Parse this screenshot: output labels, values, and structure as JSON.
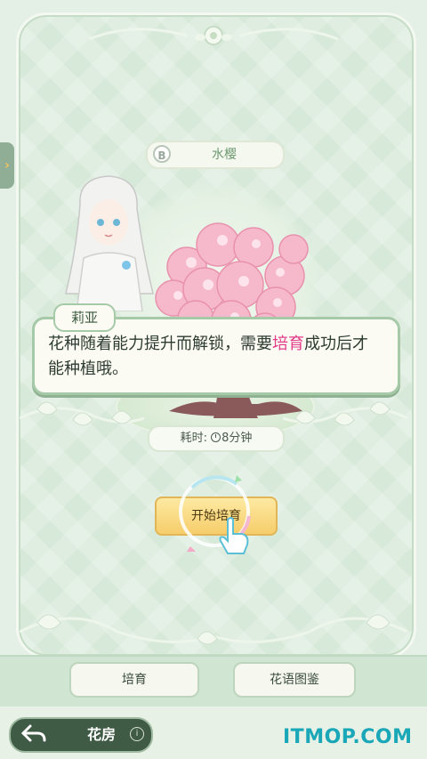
{
  "flower": {
    "grade": "B",
    "name": "水樱"
  },
  "dialog": {
    "speaker": "莉亚",
    "text_before": "花种随着能力提升而解锁，需要",
    "text_highlight": "培育",
    "text_after": "成功后才能种植哦。"
  },
  "timer": {
    "label": "耗时:",
    "value": "8分钟"
  },
  "start_button": "开始培育",
  "tabs": [
    {
      "label": "培育"
    },
    {
      "label": "花语图鉴"
    }
  ],
  "nav": {
    "back_label": "花房",
    "info_symbol": "i"
  },
  "watermark": "ITMOP.COM",
  "side_tab_symbol": "›",
  "colors": {
    "highlight": "#e33a88",
    "button": "#f6cd6b",
    "frame": "#d7e9d9",
    "dialog_border": "#a6c9a7"
  }
}
